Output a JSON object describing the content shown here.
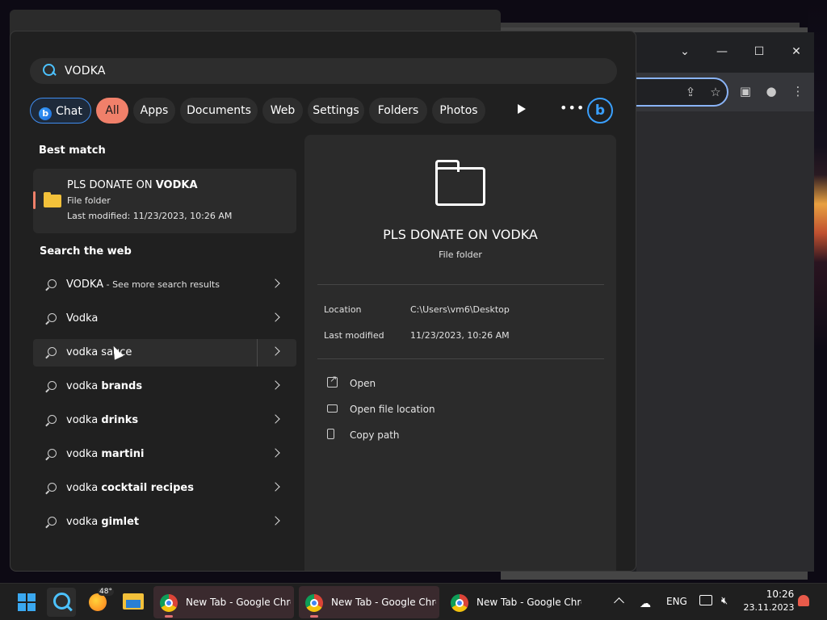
{
  "search": {
    "query": "VODKA"
  },
  "filters": [
    {
      "label": "Chat"
    },
    {
      "label": "All"
    },
    {
      "label": "Apps"
    },
    {
      "label": "Documents"
    },
    {
      "label": "Web"
    },
    {
      "label": "Settings"
    },
    {
      "label": "Folders"
    },
    {
      "label": "Photos"
    }
  ],
  "best_match": {
    "title": "Best match",
    "name_prefix": "PLS DONATE ON ",
    "name_bold": "VODKA",
    "type": "File folder",
    "modified": "Last modified: 11/23/2023, 10:26 AM"
  },
  "web": {
    "title": "Search the web",
    "items": [
      {
        "prefix": "VODKA",
        "bold": "",
        "suffix": " - See more search results"
      },
      {
        "prefix": "Vodka",
        "bold": "",
        "suffix": ""
      },
      {
        "prefix": "vodka sa",
        "bold": "",
        "suffix": "uce"
      },
      {
        "prefix": "vodka ",
        "bold": "brands",
        "suffix": ""
      },
      {
        "prefix": "vodka ",
        "bold": "drinks",
        "suffix": ""
      },
      {
        "prefix": "vodka ",
        "bold": "martini",
        "suffix": ""
      },
      {
        "prefix": "vodka ",
        "bold": "cocktail recipes",
        "suffix": ""
      },
      {
        "prefix": "vodka ",
        "bold": "gimlet",
        "suffix": ""
      }
    ]
  },
  "preview": {
    "name": "PLS DONATE ON VODKA",
    "type": "File folder",
    "location_label": "Location",
    "location_value": "C:\\Users\\vm6\\Desktop",
    "modified_label": "Last modified",
    "modified_value": "11/23/2023, 10:26 AM",
    "actions": [
      "Open",
      "Open file location",
      "Copy path"
    ]
  },
  "taskbar": {
    "weather_temp": "48°",
    "apps": [
      "New Tab - Google Chrome",
      "New Tab - Google Chrome",
      "New Tab - Google Chrome"
    ],
    "language": "ENG",
    "time": "10:26",
    "date": "23.11.2023"
  },
  "colors": {
    "accent": "#f0806a",
    "search_blue": "#4cc2ff",
    "panel_bg": "#202020"
  }
}
